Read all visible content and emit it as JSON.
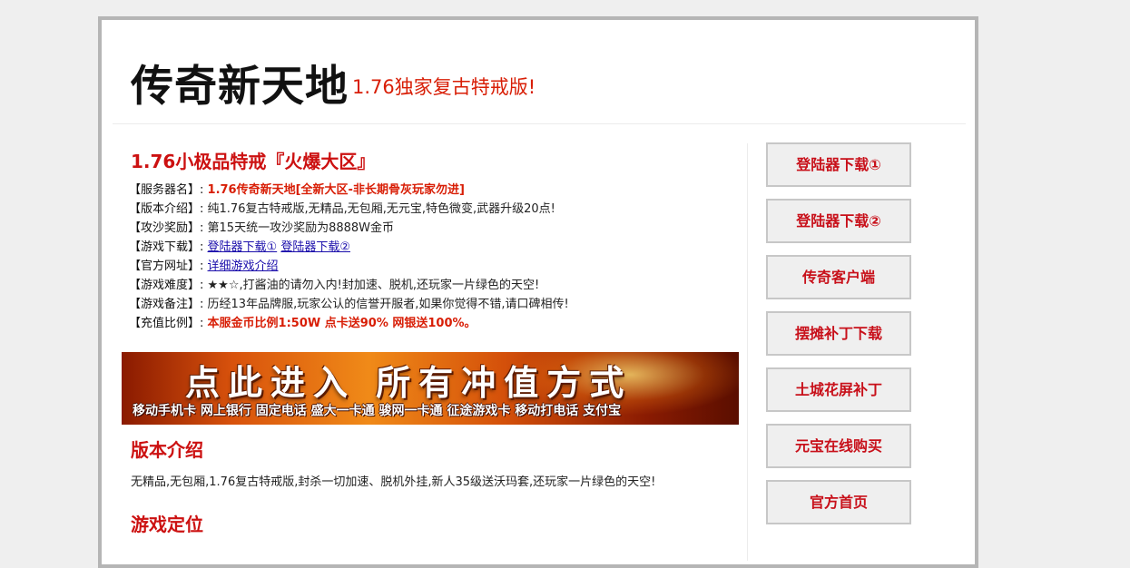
{
  "header": {
    "title": "传奇新天地",
    "subtitle": "1.76独家复古特戒版!"
  },
  "intro": {
    "heading": "1.76小极品特戒『火爆大区』",
    "rows": {
      "server": {
        "label": "【服务器名】:",
        "value": "1.76传奇新天地[全新大区-非长期骨灰玩家勿进]"
      },
      "version": {
        "label": "【版本介绍】:",
        "value": "纯1.76复古特戒版,无精品,无包厢,无元宝,特色微变,武器升级20点!"
      },
      "siege": {
        "label": "【攻沙奖励】:",
        "value": "第15天统一攻沙奖励为8888W金币"
      },
      "download": {
        "label": "【游戏下载】:",
        "link1": "登陆器下载①",
        "link2": "登陆器下载②"
      },
      "site": {
        "label": "【官方网址】:",
        "link": "详细游戏介绍"
      },
      "difficulty": {
        "label": "【游戏难度】:",
        "value": "★★☆,打酱油的请勿入内!封加速、脱机,还玩家一片绿色的天空!"
      },
      "note": {
        "label": "【游戏备注】:",
        "value": "历经13年品牌服,玩家公认的信誉开服者,如果你觉得不错,请口碑相传!"
      },
      "recharge": {
        "label": "【充值比例】:",
        "value": "本服金币比例1:50W 点卡送90% 网银送100%。"
      }
    }
  },
  "banner": {
    "main_text": "点此进入 所有冲值方式",
    "sub_text": "移动手机卡 网上银行 固定电话 盛大一卡通 骏网一卡通 征途游戏卡 移动打电话 支付宝"
  },
  "version_section": {
    "heading": "版本介绍",
    "text": "无精品,无包厢,1.76复古特戒版,封杀一切加速、脱机外挂,新人35级送沃玛套,还玩家一片绿色的天空!"
  },
  "position_section": {
    "heading": "游戏定位"
  },
  "sidebar": {
    "buttons": [
      {
        "label": "登陆器下载①"
      },
      {
        "label": "登陆器下载②"
      },
      {
        "label": "传奇客户端"
      },
      {
        "label": "摆摊补丁下载"
      },
      {
        "label": "土城花屏补丁"
      },
      {
        "label": "元宝在线购买"
      },
      {
        "label": "官方首页"
      }
    ]
  },
  "colors": {
    "accent_red": "#d81e06",
    "heading_red": "#cc1111",
    "link_blue": "#1a0dab",
    "frame_border": "#b5b5b5"
  }
}
